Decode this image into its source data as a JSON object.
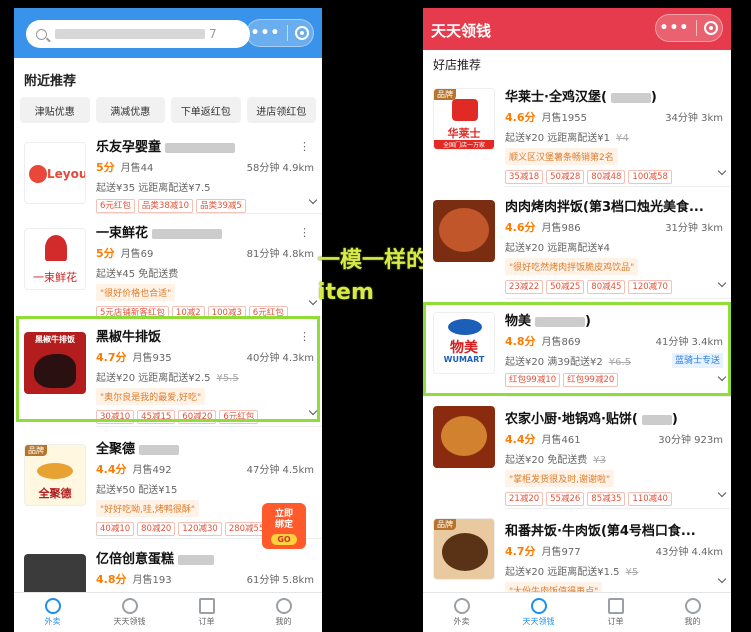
{
  "left": {
    "search_placeholder_suffix": "7",
    "nearby_title": "附近推荐",
    "filters": [
      "津贴优惠",
      "满减优惠",
      "下单返红包",
      "进店领红包"
    ],
    "shops": [
      {
        "name": "乐友孕婴童",
        "logo_text": "Leyou",
        "score": "5分",
        "monthly": "月售44",
        "time_dist": "58分钟 4.9km",
        "delivery": "起送¥35  远距离配送¥7.5",
        "quote": "",
        "tags": [
          "6元红包",
          "品类38减10",
          "品类39减5"
        ]
      },
      {
        "name": "一束鲜花",
        "logo_text": "一束鲜花",
        "score": "5分",
        "monthly": "月售69",
        "time_dist": "81分钟 4.8km",
        "delivery": "起送¥45  免配送费",
        "quote": "\"很好价格也合适\"",
        "tags": [
          "5元店铺新客红包",
          "10减2",
          "100减3",
          "6元红包"
        ]
      },
      {
        "name": "黑椒牛排饭",
        "logo_text": "黑椒牛排饭",
        "score": "4.7分",
        "monthly": "月售935",
        "time_dist": "40分钟 4.3km",
        "delivery": "起送¥20  远距离配送¥2.5",
        "delivery_strike": "¥5.5",
        "quote": "\"奥尔良是我的最爱,好吃\"",
        "tags": [
          "30减10",
          "45减15",
          "60减20",
          "6元红包"
        ]
      },
      {
        "name": "全聚德",
        "badge": "品牌",
        "logo_text": "全聚德",
        "score": "4.4分",
        "monthly": "月售492",
        "time_dist": "47分钟 4.5km",
        "delivery": "起送¥50  配送¥15",
        "quote": "\"好好吃呦,哇,烤鸭很酥\"",
        "tags": [
          "40减10",
          "80减20",
          "120减30",
          "280减55"
        ]
      },
      {
        "name": "亿倍创意蛋糕",
        "logo_text": "",
        "score": "4.8分",
        "monthly": "月售193",
        "time_dist": "61分钟 5.8km",
        "delivery": "",
        "quote": "",
        "tags": []
      }
    ],
    "coupon_float": {
      "line1": "立即",
      "line2": "绑定",
      "go": "GO"
    },
    "nav": [
      "外卖",
      "天天领钱",
      "订单",
      "我的"
    ]
  },
  "right": {
    "title": "天天领钱",
    "section": "好店推荐",
    "shops": [
      {
        "name": "华莱士·全鸡汉堡(",
        "name_end": ")",
        "badge": "品牌",
        "logo_text": "华莱士",
        "logo_sub": "全国门店一万家",
        "score": "4.6分",
        "monthly": "月售1955",
        "time_dist": "34分钟 3km",
        "delivery": "起送¥20  远距离配送¥1",
        "delivery_strike": "¥4",
        "quote": "顺义区汉堡薯条畅销第2名",
        "tags": [
          "35减18",
          "50减28",
          "80减48",
          "100减58"
        ]
      },
      {
        "name": "肉肉烤肉拌饭(第3档口烛光美食...",
        "score": "4.6分",
        "monthly": "月售986",
        "time_dist": "31分钟 3km",
        "delivery": "起送¥20  远距离配送¥4",
        "quote": "\"很好吃然烤肉拌饭脆皮鸡饮品\"",
        "tags": [
          "23减22",
          "50减25",
          "80减45",
          "120减70"
        ]
      },
      {
        "name": "物美",
        "name_end": ")",
        "logo_text": "物美",
        "logo_sub": "WUMART",
        "score": "4.8分",
        "monthly": "月售869",
        "time_dist": "41分钟 3.4km",
        "delivery": "起送¥20  满39配送¥2",
        "delivery_strike": "¥6.5",
        "special": "蓝骑士专送",
        "quote": "",
        "tags": [
          "红包99减10",
          "红包99减20"
        ]
      },
      {
        "name": "农家小厨·地锅鸡·贴饼(",
        "name_end": ")",
        "score": "4.4分",
        "monthly": "月售461",
        "time_dist": "30分钟 923m",
        "delivery": "起送¥20  免配送费",
        "delivery_strike": "¥3",
        "quote": "\"掌柜发货很及时,谢谢啦\"",
        "tags": [
          "21减20",
          "55减26",
          "85减35",
          "110减40"
        ]
      },
      {
        "name": "和番丼饭·牛肉饭(第4号档口食...",
        "badge": "品牌",
        "score": "4.7分",
        "monthly": "月售977",
        "time_dist": "43分钟 4.4km",
        "delivery": "起送¥20  远距离配送¥1.5",
        "delivery_strike": "¥5",
        "quote": "\"大份牛肉饭值得再点\"",
        "tags": []
      }
    ],
    "nav": [
      "外卖",
      "天天领钱",
      "订单",
      "我的"
    ]
  },
  "annotation": {
    "line1": "一模一样的",
    "line2": "item"
  },
  "colors": {
    "left_header": "#3a93ea",
    "right_header": "#e53b4c",
    "highlight": "#8fdc3a",
    "annotation": "#d8e94a",
    "score": "#ff7a00"
  }
}
